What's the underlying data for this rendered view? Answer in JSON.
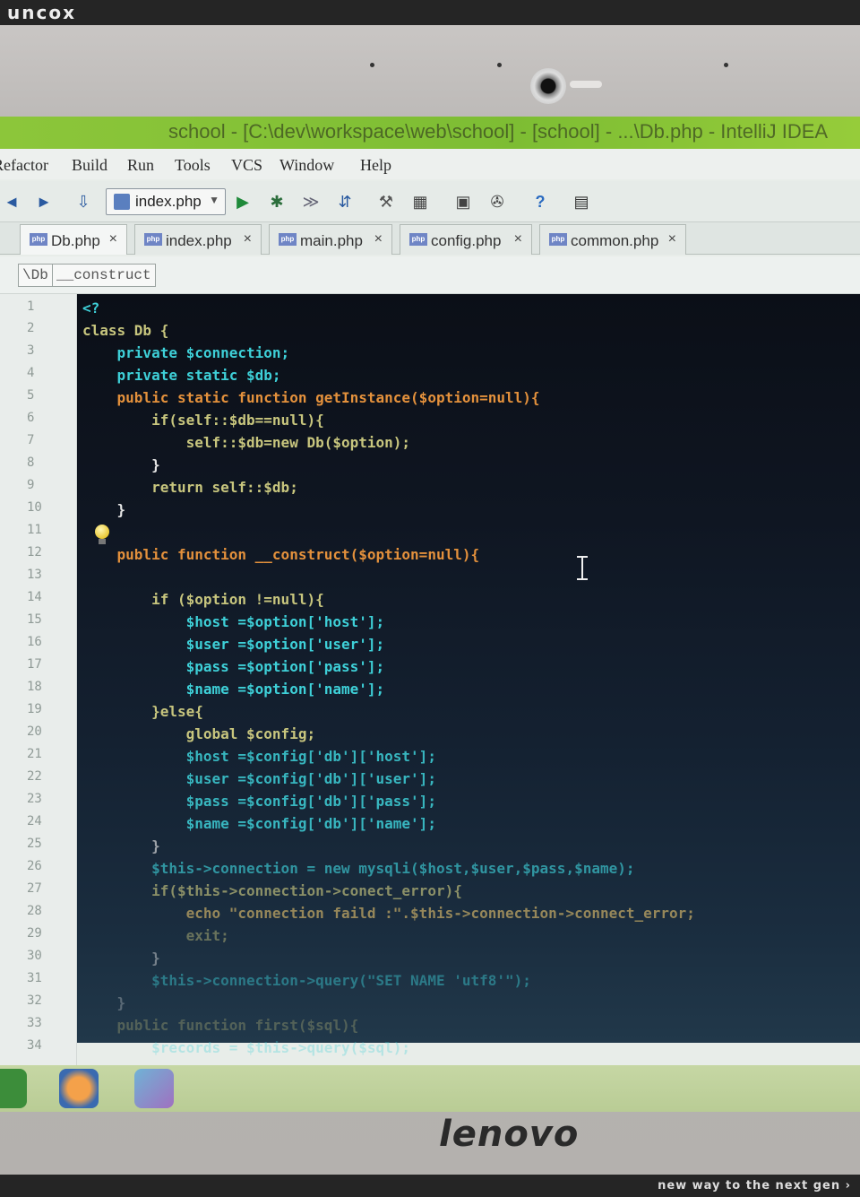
{
  "watermark": {
    "logo": "uncox",
    "slogan": "new way to the next gen ›"
  },
  "device": {
    "brand": "lenovo"
  },
  "window": {
    "title": "school - [C:\\dev\\workspace\\web\\school] - [school] - ...\\Db.php - IntelliJ IDEA"
  },
  "menu": [
    "Refactor",
    "Build",
    "Run",
    "Tools",
    "VCS",
    "Window",
    "Help"
  ],
  "toolbar": {
    "run_config": "index.php"
  },
  "tabs": [
    {
      "label": "Db.php",
      "active": true
    },
    {
      "label": "index.php",
      "active": false
    },
    {
      "label": "main.php",
      "active": false
    },
    {
      "label": "config.php",
      "active": false
    },
    {
      "label": "common.php",
      "active": false
    }
  ],
  "breadcrumb": [
    "\\Db",
    "__construct"
  ],
  "editor": {
    "line_numbers": [
      "1",
      "2",
      "3",
      "4",
      "5",
      "6",
      "7",
      "8",
      "9",
      "10",
      "11",
      "12",
      "13",
      "14",
      "15",
      "16",
      "17",
      "18",
      "19",
      "20",
      "21",
      "22",
      "23",
      "24",
      "25",
      "26",
      "27",
      "28",
      "29",
      "30",
      "31",
      "32",
      "33",
      "34"
    ],
    "lines": [
      "<?",
      "class Db {",
      "    private $connection;",
      "    private static $db;",
      "    public static function getInstance($option=null){",
      "        if(self::$db==null){",
      "            self::$db=new Db($option);",
      "        }",
      "        return self::$db;",
      "    }",
      "",
      "    public function __construct($option=null){",
      "",
      "        if ($option !=null){",
      "            $host =$option['host'];",
      "            $user =$option['user'];",
      "            $pass =$option['pass'];",
      "            $name =$option['name'];",
      "        }else{",
      "            global $config;",
      "            $host =$config['db']['host'];",
      "            $user =$config['db']['user'];",
      "            $pass =$config['db']['pass'];",
      "            $name =$config['db']['name'];",
      "        }",
      "        $this->connection = new mysqli($host,$user,$pass,$name);",
      "        if($this->connection->conect_error){",
      "            echo \"connection faild :\".$this->connection->connect_error;",
      "            exit;",
      "        }",
      "        $this->connection->query(\"SET NAME 'utf8'\");",
      "    }",
      "    public function first($sql){",
      "        $records = $this->query($sql);"
    ]
  }
}
